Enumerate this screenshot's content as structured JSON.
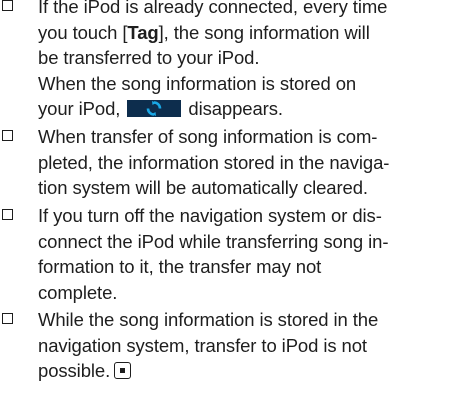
{
  "notes": [
    {
      "lines": [
        {
          "pre": "If the iPod is already connected, every time"
        },
        {
          "pre": "you touch [",
          "bold": "Tag",
          "post": "], the song information will"
        },
        {
          "pre": "be transferred to your iPod."
        },
        {
          "pre": "When the song information is stored on"
        },
        {
          "pre": "your iPod, ",
          "post": " disappears."
        }
      ]
    },
    {
      "lines": [
        {
          "pre": "When transfer of song information is com-"
        },
        {
          "pre": "pleted, the information stored in the naviga-"
        },
        {
          "pre": "tion system will be automatically cleared."
        }
      ]
    },
    {
      "lines": [
        {
          "pre": "If you turn off the navigation system or dis-"
        },
        {
          "pre": "connect the iPod while transferring song in-"
        },
        {
          "pre": "formation to it, the transfer may not"
        },
        {
          "pre": "complete."
        }
      ]
    },
    {
      "lines": [
        {
          "pre": "While the song information is stored in the"
        },
        {
          "pre": "navigation system, transfer to iPod is not"
        },
        {
          "pre": "possible."
        }
      ]
    }
  ],
  "icons": {
    "sync": "sync-status-icon",
    "end": "end-of-section-icon",
    "bullet": "checkbox-bullet-icon"
  },
  "colors": {
    "text": "#1e1e1e",
    "sync_icon_bg": "#0d2d4d",
    "sync_icon_fg": "#1aa8e6"
  }
}
